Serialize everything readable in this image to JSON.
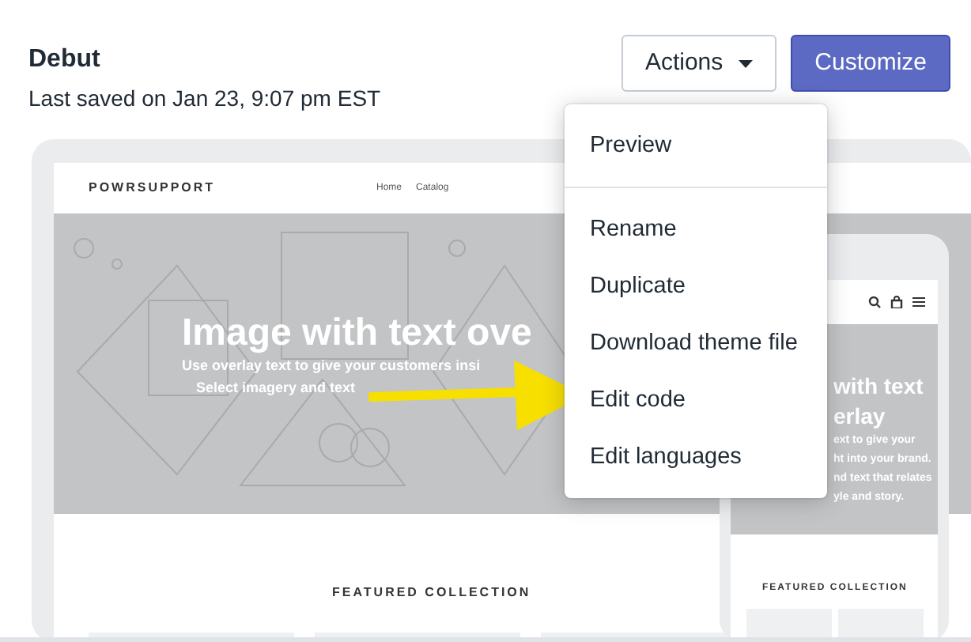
{
  "header": {
    "title": "Debut",
    "subtitle": "Last saved on Jan 23, 9:07 pm EST"
  },
  "buttons": [
    {
      "label": "Actions",
      "kind": "dropdown"
    },
    {
      "label": "Customize",
      "kind": "primary"
    }
  ],
  "menu": {
    "sections": [
      [
        "Preview"
      ],
      [
        "Rename",
        "Duplicate",
        "Download theme file",
        "Edit code",
        "Edit languages"
      ]
    ]
  },
  "desktop_preview": {
    "logo": "POWRSUPPORT",
    "nav": [
      "Home",
      "Catalog"
    ],
    "hero_title": "Image with text ove",
    "hero_lines": [
      "Use overlay text to give your customers insi",
      "Select imagery and text"
    ],
    "section_title": "FEATURED COLLECTION"
  },
  "mobile_preview": {
    "hero_title_lines": [
      "with text",
      "erlay"
    ],
    "hero_lines": [
      "ext to give your",
      "ht into your brand.",
      "nd text that relates",
      "yle and story."
    ],
    "section_title": "FEATURED COLLECTION"
  }
}
